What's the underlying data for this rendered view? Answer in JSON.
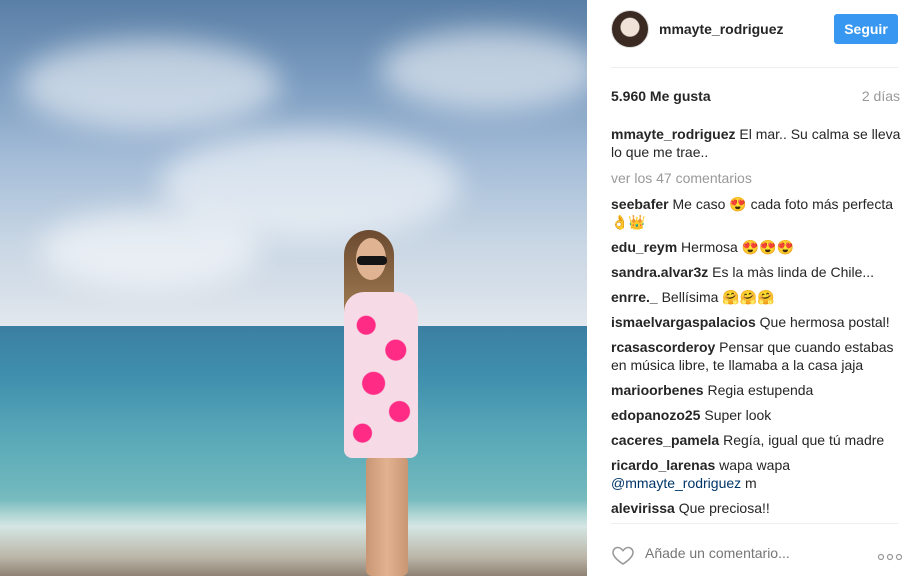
{
  "post": {
    "username": "mmayte_rodriguez",
    "follow_label": "Seguir",
    "likes": "5.960 Me gusta",
    "time": "2 días",
    "caption": {
      "author": "mmayte_rodriguez",
      "text": " El mar.. Su calma se lleva lo que me trae.."
    },
    "view_all": "ver los 47 comentarios",
    "comments": [
      {
        "author": "seebafer",
        "text": " Me caso 😍 cada foto más perfecta👌👑"
      },
      {
        "author": "edu_reym",
        "text": " Hermosa 😍😍😍"
      },
      {
        "author": "sandra.alvar3z",
        "text": " Es la màs linda de Chile..."
      },
      {
        "author": "enrre._",
        "text": " Bellísima 🤗🤗🤗"
      },
      {
        "author": "ismaelvargaspalacios",
        "text": " Que hermosa postal!"
      },
      {
        "author": "rcasascorderoy",
        "text": " Pensar que cuando estabas en música libre, te llamaba a la casa jaja"
      },
      {
        "author": "marioorbenes",
        "text": " Regia estupenda"
      },
      {
        "author": "edopanozo25",
        "text": " Super look"
      },
      {
        "author": "caceres_pamela",
        "text": " Regía, igual que tú madre"
      },
      {
        "author": "ricardo_larenas",
        "text": " wapa wapa",
        "mention": "@mmayte_rodriguez",
        "after": " m"
      },
      {
        "author": "alevirissa",
        "text": " Que preciosa!!"
      }
    ],
    "add_comment_placeholder": "Añade un comentario...",
    "icons": {
      "like": "heart-icon",
      "more": "more-options-icon"
    },
    "colors": {
      "follow_button": "#3897f0",
      "mention": "#003569"
    }
  }
}
